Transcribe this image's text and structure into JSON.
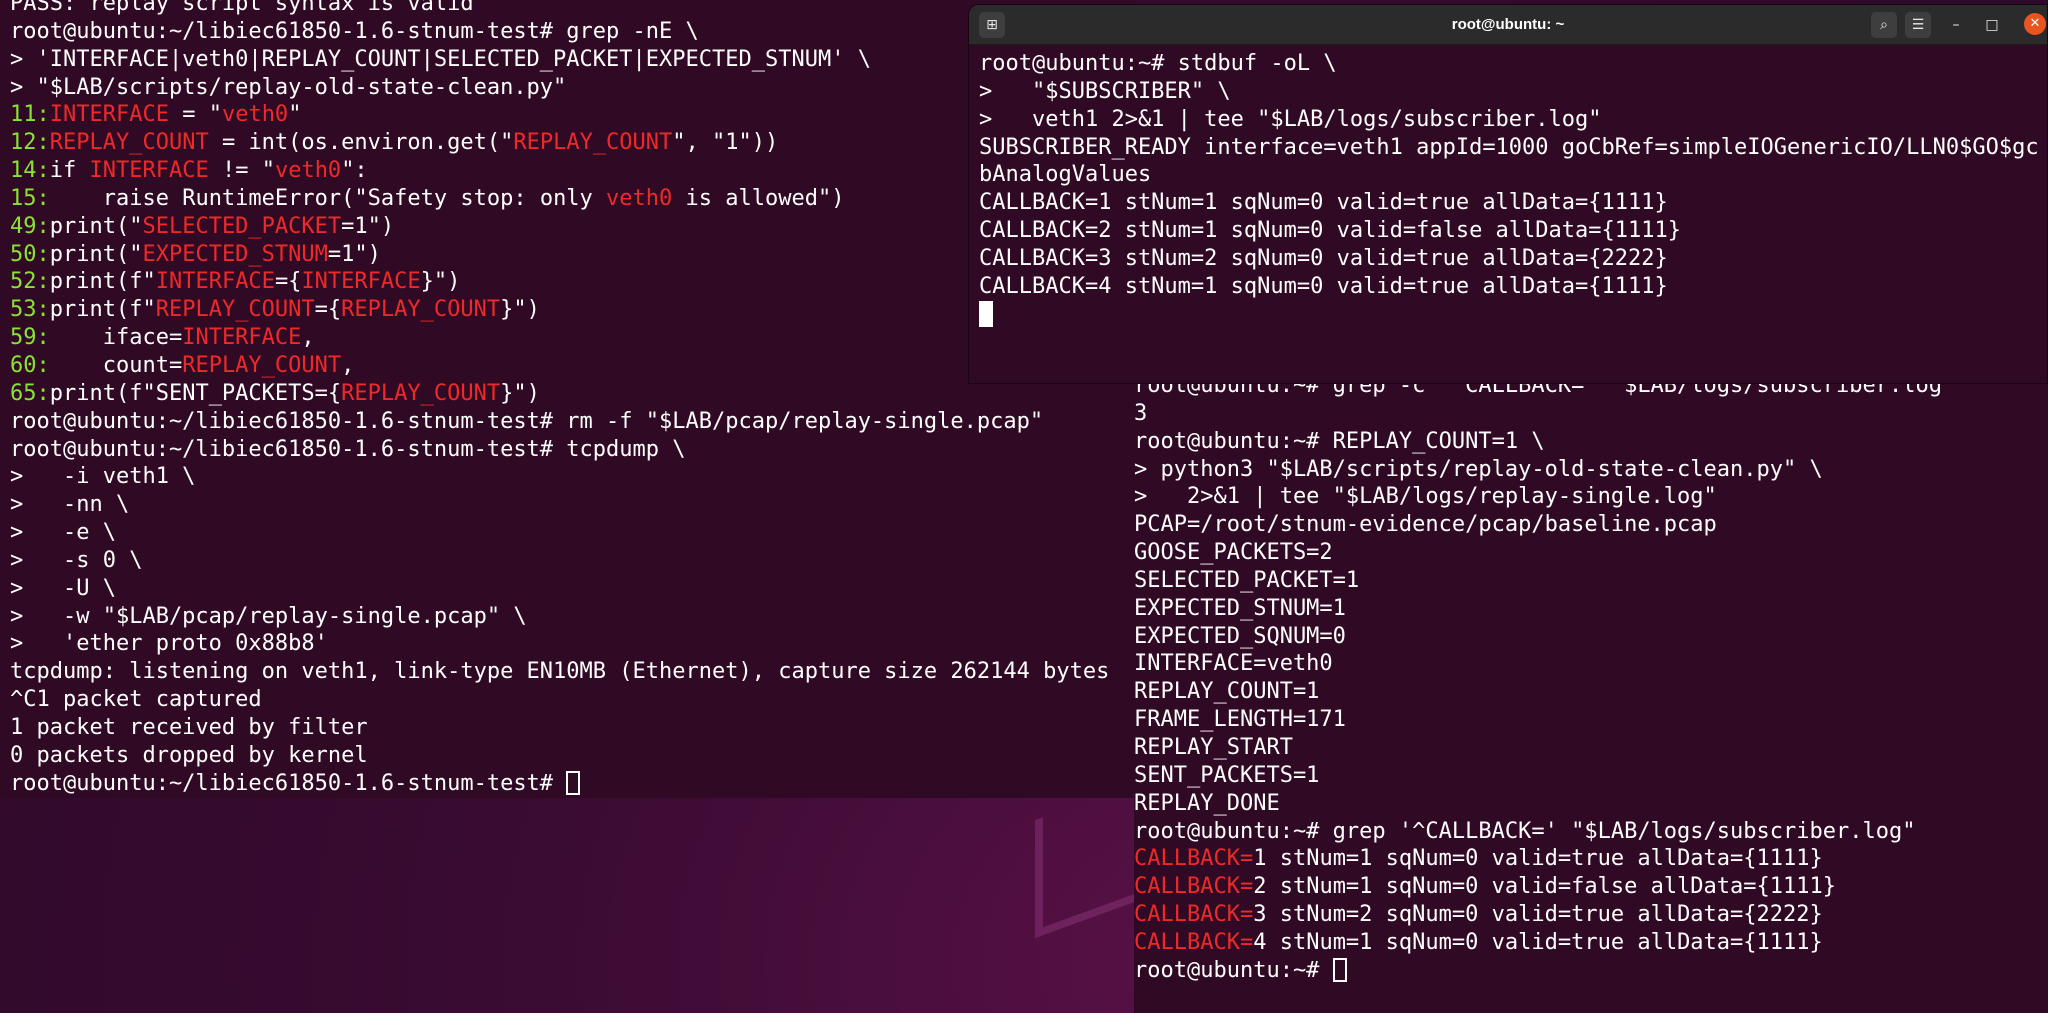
{
  "left_terminal": {
    "lines": [
      {
        "segments": [
          {
            "t": "PASS: replay script syntax is valid",
            "c": ""
          }
        ]
      },
      {
        "segments": [
          {
            "t": "root@ubuntu:~/libiec61850-1.6-stnum-test# grep -nE \\",
            "c": ""
          }
        ]
      },
      {
        "segments": [
          {
            "t": "> 'INTERFACE|veth0|REPLAY_COUNT|SELECTED_PACKET|EXPECTED_STNUM' \\",
            "c": ""
          }
        ]
      },
      {
        "segments": [
          {
            "t": "> \"$LAB/scripts/replay-old-state-clean.py\"",
            "c": ""
          }
        ]
      },
      {
        "segments": [
          {
            "t": "11:",
            "c": "grn"
          },
          {
            "t": "INTERFACE",
            "c": "red"
          },
          {
            "t": " = \"",
            "c": ""
          },
          {
            "t": "veth0",
            "c": "red"
          },
          {
            "t": "\"",
            "c": ""
          }
        ]
      },
      {
        "segments": [
          {
            "t": "12:",
            "c": "grn"
          },
          {
            "t": "REPLAY_COUNT",
            "c": "red"
          },
          {
            "t": " = int(os.environ.get(\"",
            "c": ""
          },
          {
            "t": "REPLAY_COUNT",
            "c": "red"
          },
          {
            "t": "\", \"1\"))",
            "c": ""
          }
        ]
      },
      {
        "segments": [
          {
            "t": "14:",
            "c": "grn"
          },
          {
            "t": "if ",
            "c": ""
          },
          {
            "t": "INTERFACE",
            "c": "red"
          },
          {
            "t": " != \"",
            "c": ""
          },
          {
            "t": "veth0",
            "c": "red"
          },
          {
            "t": "\":",
            "c": ""
          }
        ]
      },
      {
        "segments": [
          {
            "t": "15:",
            "c": "grn"
          },
          {
            "t": "    raise RuntimeError(\"Safety stop: only ",
            "c": ""
          },
          {
            "t": "veth0",
            "c": "red"
          },
          {
            "t": " is allowed\")",
            "c": ""
          }
        ]
      },
      {
        "segments": [
          {
            "t": "49:",
            "c": "grn"
          },
          {
            "t": "print(\"",
            "c": ""
          },
          {
            "t": "SELECTED_PACKET",
            "c": "red"
          },
          {
            "t": "=1\")",
            "c": ""
          }
        ]
      },
      {
        "segments": [
          {
            "t": "50:",
            "c": "grn"
          },
          {
            "t": "print(\"",
            "c": ""
          },
          {
            "t": "EXPECTED_STNUM",
            "c": "red"
          },
          {
            "t": "=1\")",
            "c": ""
          }
        ]
      },
      {
        "segments": [
          {
            "t": "52:",
            "c": "grn"
          },
          {
            "t": "print(f\"",
            "c": ""
          },
          {
            "t": "INTERFACE",
            "c": "red"
          },
          {
            "t": "={",
            "c": ""
          },
          {
            "t": "INTERFACE",
            "c": "red"
          },
          {
            "t": "}\")",
            "c": ""
          }
        ]
      },
      {
        "segments": [
          {
            "t": "53:",
            "c": "grn"
          },
          {
            "t": "print(f\"",
            "c": ""
          },
          {
            "t": "REPLAY_COUNT",
            "c": "red"
          },
          {
            "t": "={",
            "c": ""
          },
          {
            "t": "REPLAY_COUNT",
            "c": "red"
          },
          {
            "t": "}\")",
            "c": ""
          }
        ]
      },
      {
        "segments": [
          {
            "t": "59:",
            "c": "grn"
          },
          {
            "t": "    iface=",
            "c": ""
          },
          {
            "t": "INTERFACE",
            "c": "red"
          },
          {
            "t": ",",
            "c": ""
          }
        ]
      },
      {
        "segments": [
          {
            "t": "60:",
            "c": "grn"
          },
          {
            "t": "    count=",
            "c": ""
          },
          {
            "t": "REPLAY_COUNT",
            "c": "red"
          },
          {
            "t": ",",
            "c": ""
          }
        ]
      },
      {
        "segments": [
          {
            "t": "65:",
            "c": "grn"
          },
          {
            "t": "print(f\"SENT_PACKETS={",
            "c": ""
          },
          {
            "t": "REPLAY_COUNT",
            "c": "red"
          },
          {
            "t": "}\")",
            "c": ""
          }
        ]
      },
      {
        "segments": [
          {
            "t": "root@ubuntu:~/libiec61850-1.6-stnum-test# rm -f \"$LAB/pcap/replay-single.pcap\"",
            "c": ""
          }
        ]
      },
      {
        "segments": [
          {
            "t": "root@ubuntu:~/libiec61850-1.6-stnum-test# tcpdump \\",
            "c": ""
          }
        ]
      },
      {
        "segments": [
          {
            "t": ">   -i veth1 \\",
            "c": ""
          }
        ]
      },
      {
        "segments": [
          {
            "t": ">   -nn \\",
            "c": ""
          }
        ]
      },
      {
        "segments": [
          {
            "t": ">   -e \\",
            "c": ""
          }
        ]
      },
      {
        "segments": [
          {
            "t": ">   -s 0 \\",
            "c": ""
          }
        ]
      },
      {
        "segments": [
          {
            "t": ">   -U \\",
            "c": ""
          }
        ]
      },
      {
        "segments": [
          {
            "t": ">   -w \"$LAB/pcap/replay-single.pcap\" \\",
            "c": ""
          }
        ]
      },
      {
        "segments": [
          {
            "t": ">   'ether proto 0x88b8'",
            "c": ""
          }
        ]
      },
      {
        "segments": [
          {
            "t": "tcpdump: listening on veth1, link-type EN10MB (Ethernet), capture size 262144 bytes",
            "c": ""
          }
        ]
      },
      {
        "segments": [
          {
            "t": "^C1 packet captured",
            "c": ""
          }
        ]
      },
      {
        "segments": [
          {
            "t": "1 packet received by filter",
            "c": ""
          }
        ]
      },
      {
        "segments": [
          {
            "t": "0 packets dropped by kernel",
            "c": ""
          }
        ]
      },
      {
        "segments": [
          {
            "t": "root@ubuntu:~/libiec61850-1.6-stnum-test# ",
            "c": ""
          }
        ],
        "cursor": "hollow"
      }
    ]
  },
  "top_terminal": {
    "title": "root@ubuntu: ~",
    "new_tab_icon": "new-tab-icon",
    "search_icon": "search-icon",
    "menu_icon": "hamburger-menu-icon",
    "lines": [
      {
        "segments": [
          {
            "t": "root@ubuntu:~# stdbuf -oL \\",
            "c": ""
          }
        ]
      },
      {
        "segments": [
          {
            "t": ">   \"$SUBSCRIBER\" \\",
            "c": ""
          }
        ]
      },
      {
        "segments": [
          {
            "t": ">   veth1 2>&1 | tee \"$LAB/logs/subscriber.log\"",
            "c": ""
          }
        ]
      },
      {
        "segments": [
          {
            "t": "SUBSCRIBER_READY interface=veth1 appId=1000 goCbRef=simpleIOGenericIO/LLN0$GO$gc",
            "c": ""
          }
        ]
      },
      {
        "segments": [
          {
            "t": "bAnalogValues",
            "c": ""
          }
        ]
      },
      {
        "segments": [
          {
            "t": "CALLBACK=1 stNum=1 sqNum=0 valid=true allData={1111}",
            "c": ""
          }
        ]
      },
      {
        "segments": [
          {
            "t": "CALLBACK=2 stNum=1 sqNum=0 valid=false allData={1111}",
            "c": ""
          }
        ]
      },
      {
        "segments": [
          {
            "t": "CALLBACK=3 stNum=2 sqNum=0 valid=true allData={2222}",
            "c": ""
          }
        ]
      },
      {
        "segments": [
          {
            "t": "CALLBACK=4 stNum=1 sqNum=0 valid=true allData={1111}",
            "c": ""
          }
        ]
      },
      {
        "segments": [],
        "cursor": "solid"
      }
    ]
  },
  "bottom_right_terminal": {
    "lines": [
      {
        "segments": [
          {
            "t": "root@ubuntu:~# grep -c '^CALLBACK=' \"$LAB/logs/subscriber.log\"",
            "c": ""
          }
        ]
      },
      {
        "segments": [
          {
            "t": "3",
            "c": ""
          }
        ]
      },
      {
        "segments": [
          {
            "t": "root@ubuntu:~# REPLAY_COUNT=1 \\",
            "c": ""
          }
        ]
      },
      {
        "segments": [
          {
            "t": "> python3 \"$LAB/scripts/replay-old-state-clean.py\" \\",
            "c": ""
          }
        ]
      },
      {
        "segments": [
          {
            "t": ">   2>&1 | tee \"$LAB/logs/replay-single.log\"",
            "c": ""
          }
        ]
      },
      {
        "segments": [
          {
            "t": "PCAP=/root/stnum-evidence/pcap/baseline.pcap",
            "c": ""
          }
        ]
      },
      {
        "segments": [
          {
            "t": "GOOSE_PACKETS=2",
            "c": ""
          }
        ]
      },
      {
        "segments": [
          {
            "t": "SELECTED_PACKET=1",
            "c": ""
          }
        ]
      },
      {
        "segments": [
          {
            "t": "EXPECTED_STNUM=1",
            "c": ""
          }
        ]
      },
      {
        "segments": [
          {
            "t": "EXPECTED_SQNUM=0",
            "c": ""
          }
        ]
      },
      {
        "segments": [
          {
            "t": "INTERFACE=veth0",
            "c": ""
          }
        ]
      },
      {
        "segments": [
          {
            "t": "REPLAY_COUNT=1",
            "c": ""
          }
        ]
      },
      {
        "segments": [
          {
            "t": "FRAME_LENGTH=171",
            "c": ""
          }
        ]
      },
      {
        "segments": [
          {
            "t": "REPLAY_START",
            "c": ""
          }
        ]
      },
      {
        "segments": [
          {
            "t": "SENT_PACKETS=1",
            "c": ""
          }
        ]
      },
      {
        "segments": [
          {
            "t": "REPLAY_DONE",
            "c": ""
          }
        ]
      },
      {
        "segments": [
          {
            "t": "root@ubuntu:~# grep '^CALLBACK=' \"$LAB/logs/subscriber.log\"",
            "c": ""
          }
        ]
      },
      {
        "segments": [
          {
            "t": "CALLBACK=",
            "c": "red"
          },
          {
            "t": "1 stNum=1 sqNum=0 valid=true allData={1111}",
            "c": ""
          }
        ]
      },
      {
        "segments": [
          {
            "t": "CALLBACK=",
            "c": "red"
          },
          {
            "t": "2 stNum=1 sqNum=0 valid=false allData={1111}",
            "c": ""
          }
        ]
      },
      {
        "segments": [
          {
            "t": "CALLBACK=",
            "c": "red"
          },
          {
            "t": "3 stNum=2 sqNum=0 valid=true allData={2222}",
            "c": ""
          }
        ]
      },
      {
        "segments": [
          {
            "t": "CALLBACK=",
            "c": "red"
          },
          {
            "t": "4 stNum=1 sqNum=0 valid=true allData={1111}",
            "c": ""
          }
        ]
      },
      {
        "segments": [
          {
            "t": "root@ubuntu:~# ",
            "c": ""
          }
        ],
        "cursor": "hollow"
      }
    ]
  },
  "colors": {
    "terminal_bg": "#300a24",
    "match_red": "#ef2929",
    "line_number_green": "#8ae234",
    "close_button": "#e95420"
  }
}
